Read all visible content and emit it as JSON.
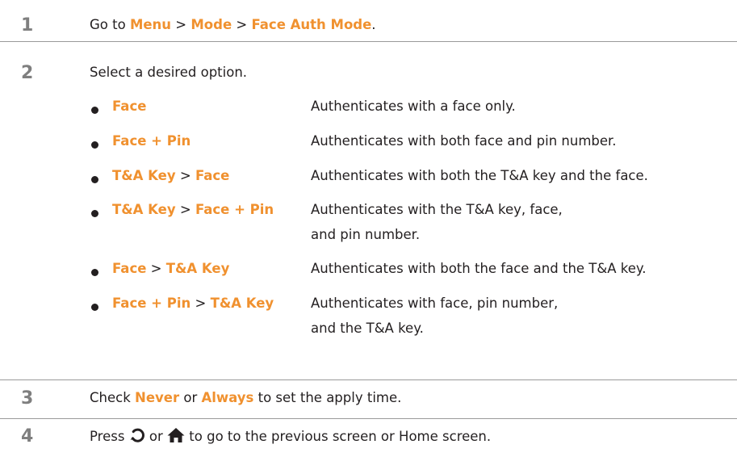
{
  "steps": [
    {
      "number": "1",
      "parts": [
        "Go to ",
        "Menu",
        " > ",
        "Mode",
        " > ",
        "Face Auth Mode",
        "."
      ]
    },
    {
      "number": "2",
      "text": "Select a desired option."
    },
    {
      "number": "3",
      "parts": [
        "Check ",
        "Never",
        " or ",
        "Always",
        " to set the apply time."
      ]
    },
    {
      "number": "4",
      "parts": [
        "Press ",
        " or ",
        " to go to the previous screen or Home screen."
      ],
      "icons": [
        "back-icon",
        "home-icon"
      ]
    }
  ],
  "options": [
    {
      "name": [
        "Face"
      ],
      "description": "Authenticates with a face only."
    },
    {
      "name": [
        "Face + Pin"
      ],
      "description": "Authenticates with both face and pin number."
    },
    {
      "name": [
        "T&A Key",
        "Face"
      ],
      "description": "Authenticates with both the T&A key and the face."
    },
    {
      "name": [
        "T&A Key",
        "Face + Pin"
      ],
      "description": "Authenticates with the T&A key, face, and pin number."
    },
    {
      "name": [
        "Face",
        "T&A Key"
      ],
      "description": "Authenticates with both the face and the T&A key."
    },
    {
      "name": [
        "Face + Pin",
        "T&A Key"
      ],
      "description": "Authenticates with face, pin number, and the T&A key."
    }
  ],
  "separator": " > ",
  "colors": {
    "highlight": "#f0912f",
    "step_number": "#7f7f7f",
    "text": "#231f20",
    "divider": "#9a9a9a"
  }
}
